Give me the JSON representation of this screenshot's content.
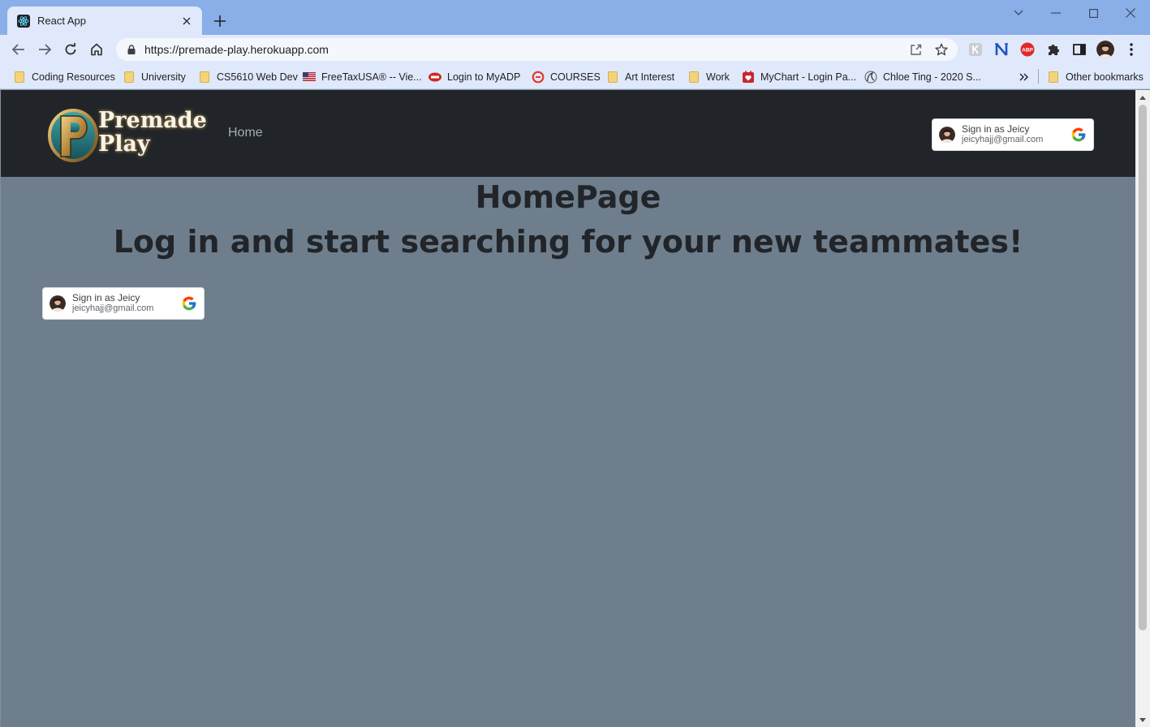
{
  "browser": {
    "tab_title": "React App",
    "url": "https://premade-play.herokuapp.com",
    "bookmarks": [
      {
        "label": "Coding Resources",
        "icon": "folder-icon"
      },
      {
        "label": "University",
        "icon": "folder-icon"
      },
      {
        "label": "CS5610 Web Dev",
        "icon": "folder-icon"
      },
      {
        "label": "FreeTaxUSA® -- Vie...",
        "icon": "us-flag-icon"
      },
      {
        "label": "Login to MyADP",
        "icon": "adp-icon"
      },
      {
        "label": "COURSES",
        "icon": "courses-icon"
      },
      {
        "label": "Art Interest",
        "icon": "folder-icon"
      },
      {
        "label": "Work",
        "icon": "folder-icon"
      },
      {
        "label": "MyChart - Login Pa...",
        "icon": "mychart-icon"
      },
      {
        "label": "Chloe Ting - 2020 S...",
        "icon": "chloe-ting-icon"
      }
    ],
    "other_bookmarks": "Other bookmarks",
    "extensions": [
      "ext-k-icon",
      "notion-icon",
      "adblock-icon",
      "puzzle-icon",
      "side-panel-icon",
      "profile-avatar",
      "menu-icon"
    ],
    "extension_abp": "ABP"
  },
  "page": {
    "brand_line1": "Premade",
    "brand_line2": "Play",
    "nav_home": "Home",
    "heading": "HomePage",
    "subheading": "Log in and start searching for your new teammates!",
    "signin_name": "Sign in as Jeicy",
    "signin_email": "jeicyhajj@gmail.com"
  },
  "colors": {
    "navbar": "#212529",
    "page_background": "#6f7e8d",
    "heading_text": "#212529",
    "tabstrip": "#8aaee8"
  }
}
